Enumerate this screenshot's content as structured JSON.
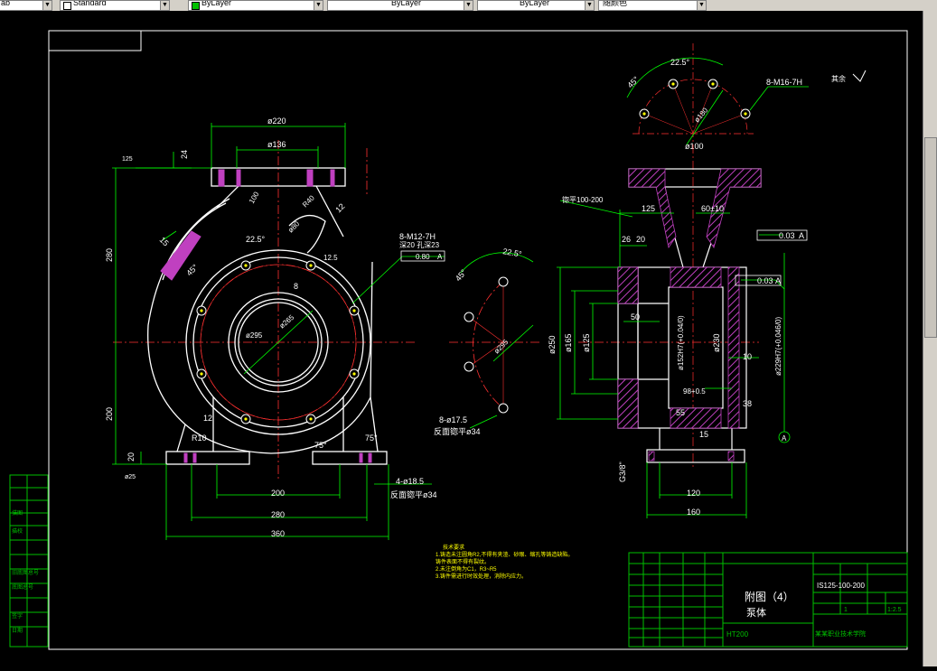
{
  "toolbar": {
    "text_style": "Standard",
    "color_control": "ByLayer",
    "linetype_control": "ByLayer",
    "lineweight_control": "ByLayer",
    "plot_style": "随颜色"
  },
  "drawing": {
    "front_view": {
      "dims": [
        "ø220",
        "ø136",
        "24",
        "125",
        "280",
        "200",
        "20",
        "200",
        "280",
        "360",
        "12",
        "R10",
        "75°",
        "75°",
        "4-ø18.5",
        "反面锪平ø34",
        "8",
        "ø295",
        "ø265",
        "22.5°",
        "45°",
        "15",
        "12",
        "ø25",
        "R40",
        "ø80",
        "100",
        "12.5",
        "8-M12-7H",
        "深20 孔深23",
        "0.80",
        "A"
      ]
    },
    "hole_view": {
      "dims": [
        "22.5°",
        "45°",
        "8-ø17.5",
        "反面锪平ø34",
        "ø295"
      ]
    },
    "flange_view": {
      "dims": [
        "22.5°",
        "45°",
        "8-M16-7H",
        "ø180",
        "ø100",
        "其余"
      ]
    },
    "section_view": {
      "dims": [
        "锪平100-200",
        "125",
        "60±10",
        "26",
        "20",
        "0.03",
        "A",
        "50",
        "ø250",
        "ø165",
        "ø125",
        "ø152H7(+0.04/0)",
        "ø230",
        "ø229H7(+0.046/0)",
        "10",
        "98+0.5",
        "38",
        "55",
        "15",
        "G3/8\"",
        "120",
        "160",
        "A"
      ]
    },
    "notes": [
      "技术要求",
      "1.铸造未注圆角R2,不得有夹渣、砂眼、缩孔等铸造缺陷。",
      "  铸件表面不得有裂纹。",
      "2.未注倒角为C1，R3~R5",
      "3.铸件需进行时效处理，消除内应力。"
    ],
    "title_block": {
      "title": "附图（4）",
      "part_name": "泵体",
      "drawing_no": "IS125-100-200",
      "material": "HT200",
      "school": "某某职业技术学院",
      "scale": "1:2.5",
      "qty": "1"
    },
    "side_labels": [
      "描图",
      "描校",
      "旧底图总号",
      "底图总号",
      "签字",
      "日期"
    ]
  }
}
